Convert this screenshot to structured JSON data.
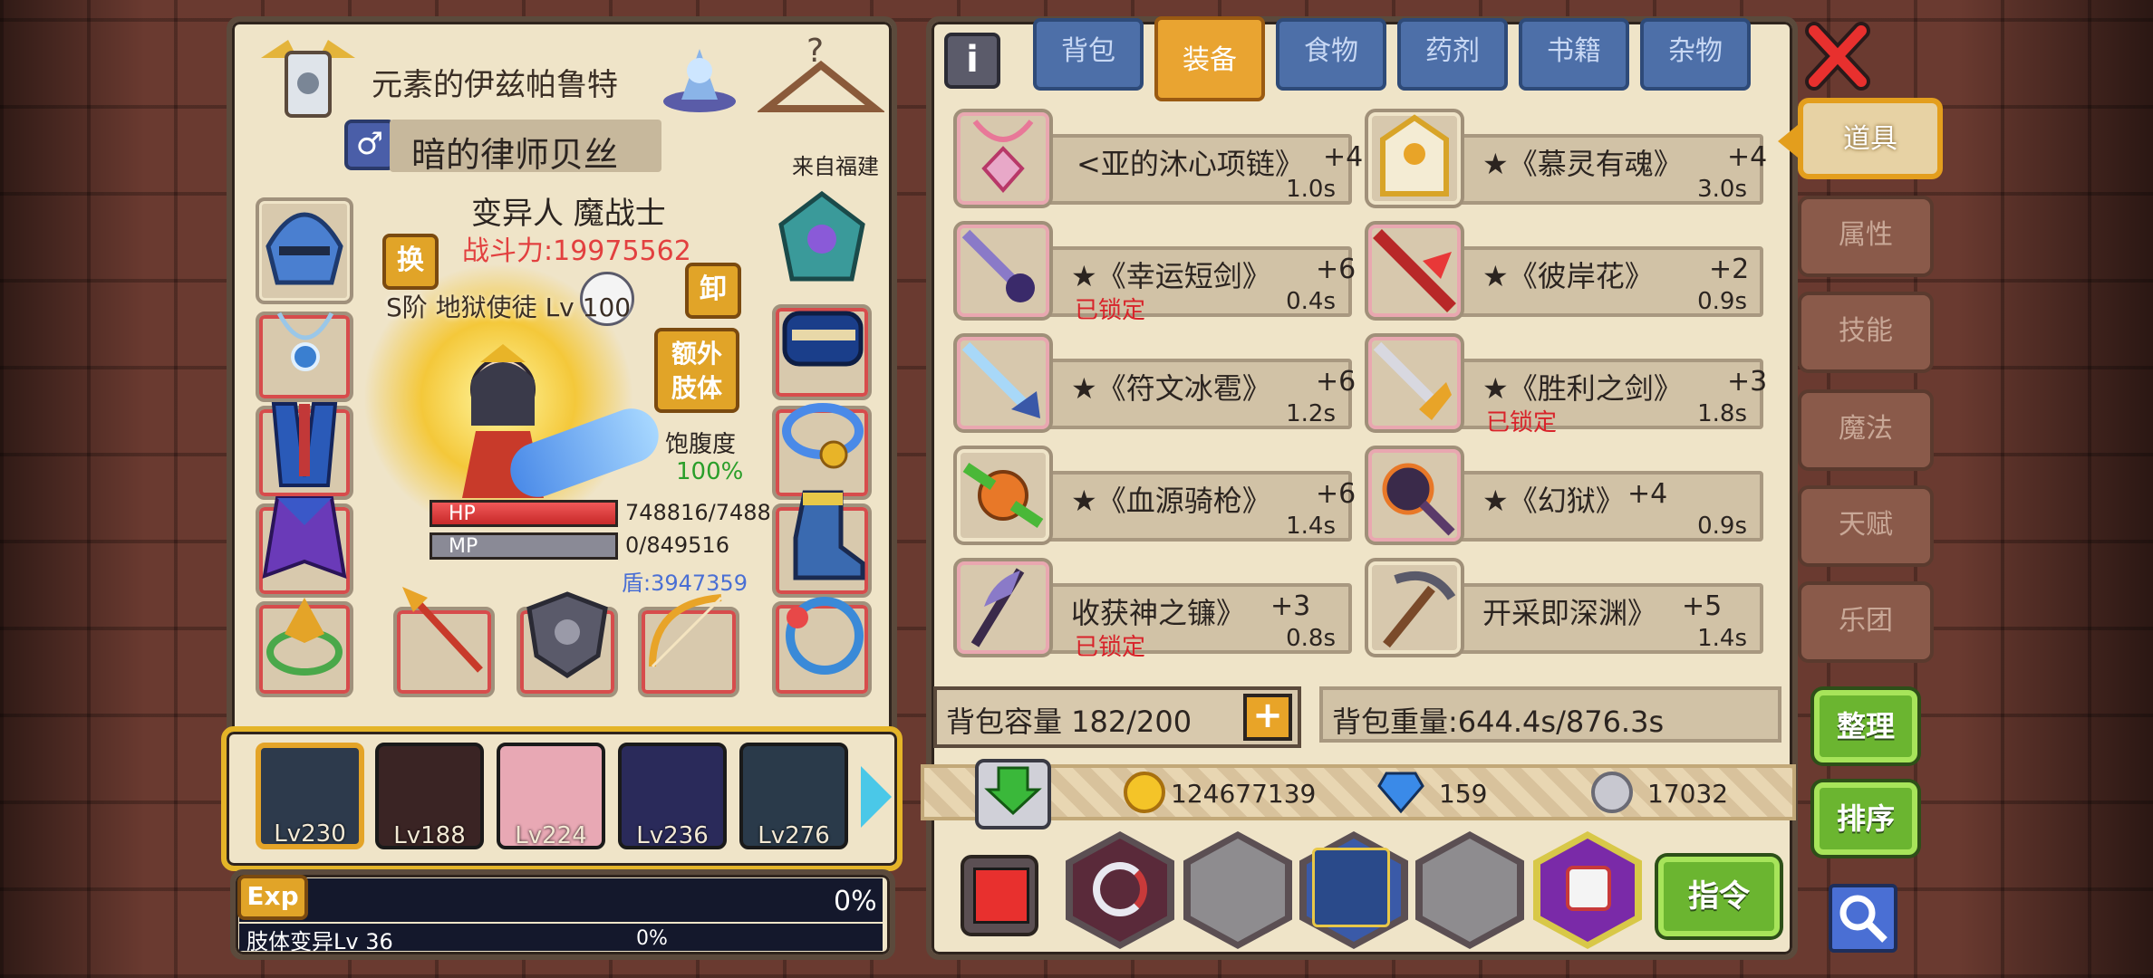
{
  "character": {
    "realm": "元素的伊兹帕鲁特",
    "name": "暗的律师贝丝",
    "origin": "来自福建",
    "class": "变异人 魔战士",
    "power": "战斗力:19975562",
    "swap_label": "换",
    "unequip_label": "卸",
    "extra_limb_label": "额外\n肢体",
    "rank_title": "S阶 地狱使徒 Lv 100",
    "satiety_label": "饱腹度",
    "satiety_value": "100%",
    "hp_label": "HP",
    "hp_value": "748816/7488",
    "hp_fraction": 1.0,
    "mp_label": "MP",
    "mp_value": "0/849516",
    "mp_fraction": 0,
    "shield": "盾:3947359"
  },
  "party": {
    "members": [
      {
        "level": "Lv230"
      },
      {
        "level": "Lv188"
      },
      {
        "level": "Lv224"
      },
      {
        "level": "Lv236"
      },
      {
        "level": "Lv276"
      }
    ]
  },
  "exp": {
    "label": "Exp",
    "percent": "0%",
    "limb_label": "肢体变异Lv 36",
    "limb_percent": "0%"
  },
  "tabs": [
    {
      "label": "背包"
    },
    {
      "label": "装备"
    },
    {
      "label": "食物"
    },
    {
      "label": "药剂"
    },
    {
      "label": "书籍"
    },
    {
      "label": "杂物"
    }
  ],
  "side_tabs": [
    {
      "label": "道具"
    },
    {
      "label": "属性"
    },
    {
      "label": "技能"
    },
    {
      "label": "魔法"
    },
    {
      "label": "天赋"
    },
    {
      "label": "乐团"
    }
  ],
  "items": [
    {
      "name": "<亚的沐心项链》",
      "level": "+4",
      "weight": "1.0s",
      "locked": ""
    },
    {
      "name": "★《慕灵有魂》",
      "level": "+4",
      "weight": "3.0s",
      "locked": ""
    },
    {
      "name": "★《幸运短剑》",
      "level": "+6",
      "weight": "0.4s",
      "locked": "已锁定"
    },
    {
      "name": "★《彼岸花》",
      "level": "+2",
      "weight": "0.9s",
      "locked": ""
    },
    {
      "name": "★《符文冰雹》",
      "level": "+6",
      "weight": "1.2s",
      "locked": ""
    },
    {
      "name": "★《胜利之剑》",
      "level": "+3",
      "weight": "1.8s",
      "locked": "已锁定"
    },
    {
      "name": "★《血源骑枪》",
      "level": "+6",
      "weight": "1.4s",
      "locked": ""
    },
    {
      "name": "★《幻狱》",
      "level": "+4",
      "weight": "0.9s",
      "locked": ""
    },
    {
      "name": "收获神之镰》",
      "level": "+3",
      "weight": "0.8s",
      "locked": "已锁定"
    },
    {
      "name": "开采即深渊》",
      "level": "+5",
      "weight": "1.4s",
      "locked": ""
    }
  ],
  "bag": {
    "capacity": "背包容量 182/200",
    "weight": "背包重量:644.4s/876.3s"
  },
  "currency": {
    "gold": "124677139",
    "gems": "159",
    "silver": "17032"
  },
  "buttons": {
    "organize": "整理",
    "sort": "排序",
    "command": "指令",
    "help": "i"
  },
  "colors": {
    "power_red": "#e2403f",
    "satiety_green": "#2a9e2a",
    "shield_blue": "#4a6fd4",
    "lock_red": "#d8232a",
    "tab_active": "#e9a431"
  }
}
